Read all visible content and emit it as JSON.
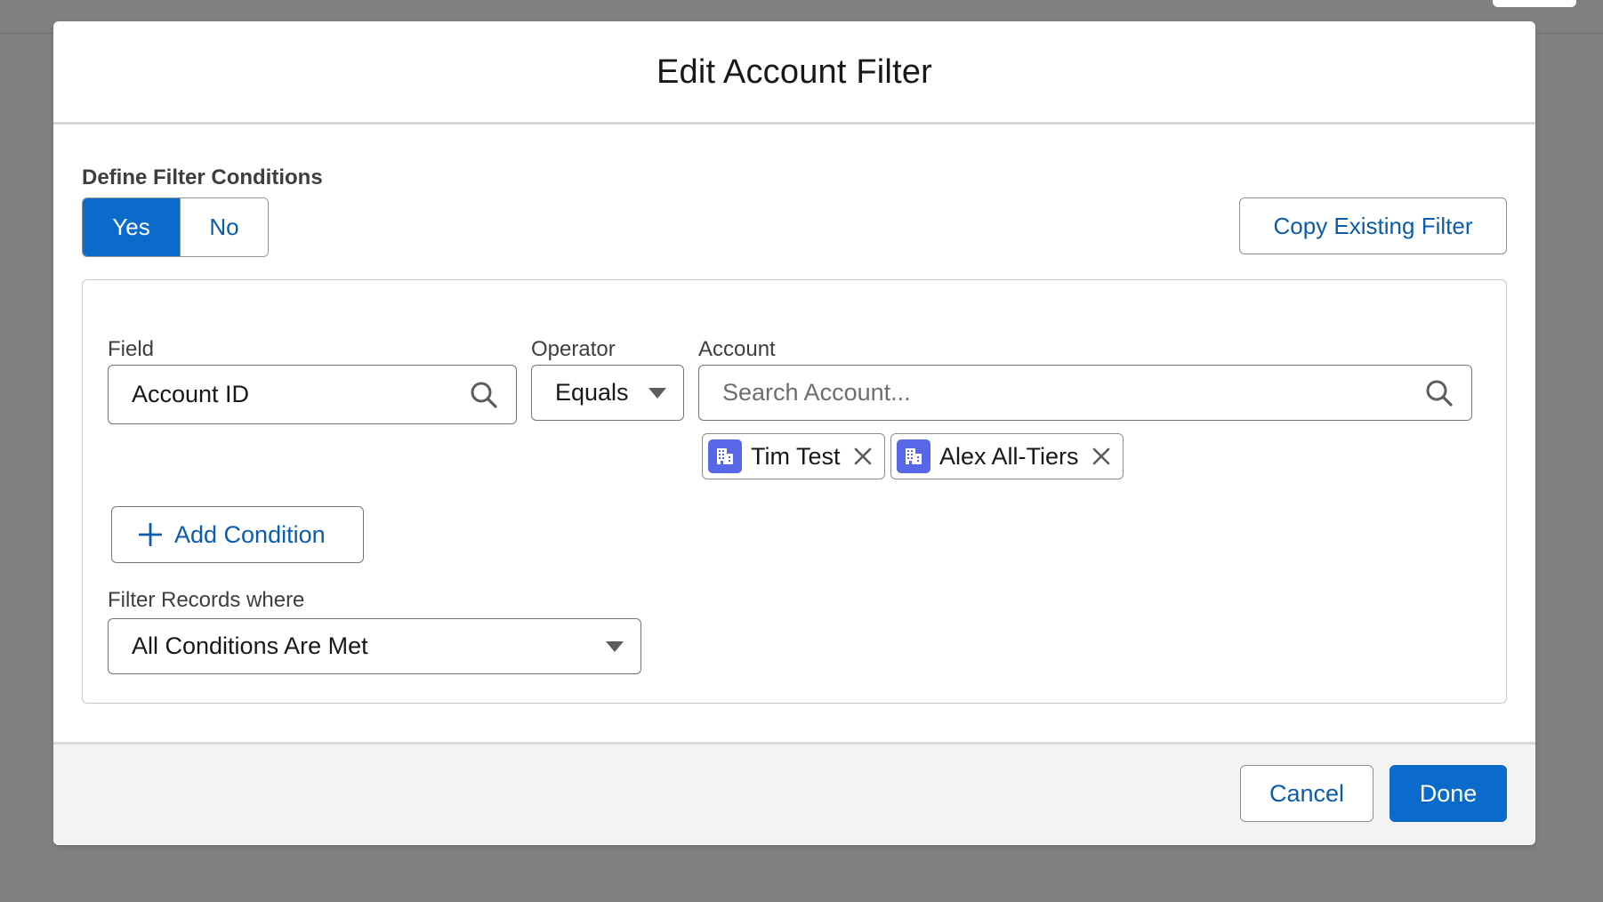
{
  "modal": {
    "title": "Edit Account Filter"
  },
  "define": {
    "label": "Define Filter Conditions",
    "yes_label": "Yes",
    "no_label": "No",
    "selected": "Yes"
  },
  "copy_button": "Copy Existing Filter",
  "condition": {
    "field_label": "Field",
    "field_value": "Account ID",
    "operator_label": "Operator",
    "operator_value": "Equals",
    "account_label": "Account",
    "account_placeholder": "Search Account...",
    "selected_accounts": [
      {
        "name": "Tim Test",
        "icon": "building-icon"
      },
      {
        "name": "Alex All-Tiers",
        "icon": "building-icon"
      }
    ]
  },
  "add_condition": "Add Condition",
  "filter_records": {
    "label": "Filter Records where",
    "value": "All Conditions Are Met"
  },
  "footer": {
    "cancel": "Cancel",
    "done": "Done"
  },
  "colors": {
    "brand": "#0b6bcb",
    "link": "#0b5cab",
    "pill_icon": "#5867e8",
    "backdrop": "#7f8081"
  }
}
